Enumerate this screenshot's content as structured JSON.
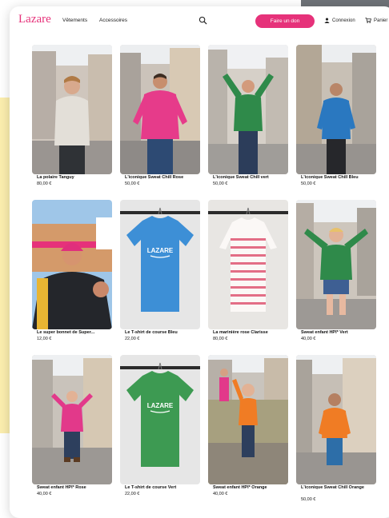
{
  "header": {
    "logo": "Lazare",
    "nav": [
      "Vêtements",
      "Accessoires"
    ],
    "donate_label": "Faire un don",
    "login_label": "Connexion",
    "cart_label": "Panier"
  },
  "products": [
    {
      "name": "La polaire Tanguy",
      "price": "80,00 €"
    },
    {
      "name": "L'iconique Sweat Chill Rose",
      "price": "50,00 €"
    },
    {
      "name": "L'iconique Sweat Chill vert",
      "price": "50,00 €"
    },
    {
      "name": "L'iconique Sweat Chill Bleu",
      "price": "50,00 €"
    },
    {
      "name": "Le super bonnet de Super...",
      "price": "12,00 €"
    },
    {
      "name": "Le T-shirt de course Bleu",
      "price": "22,00 €"
    },
    {
      "name": "La marinière rose Clarisse",
      "price": "80,00 €"
    },
    {
      "name": "Sweat enfant HPI* Vert",
      "price": "40,00 €"
    },
    {
      "name": "Sweat enfant HPI* Rose",
      "price": "40,00 €"
    },
    {
      "name": "Le T-shirt de course Vert",
      "price": "22,00 €"
    },
    {
      "name": "Sweat enfant HPI* Orange",
      "price": "40,00 €"
    },
    {
      "name": "L'iconique Sweat Chill Orange",
      "price": "50,00 €"
    }
  ],
  "tshirt_print": "LAZARE",
  "colors": {
    "brand_pink": "#e6327a",
    "yellow_bg": "#fbeeae"
  }
}
